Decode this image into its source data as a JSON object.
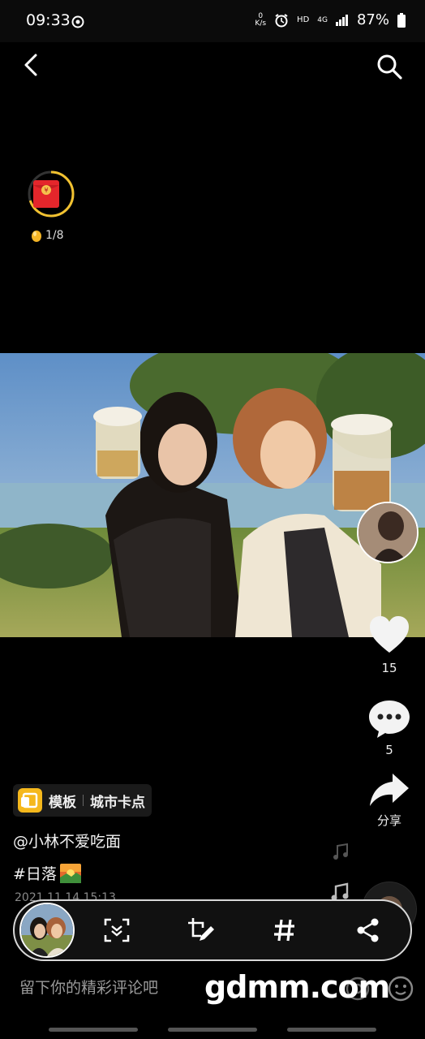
{
  "status_bar": {
    "time": "09:33",
    "net_speed_top": "0",
    "net_speed_bottom": "K/s",
    "hd": "HD",
    "network": "4G",
    "battery": "87%"
  },
  "nav": {
    "back_icon": "chevron-left-icon",
    "search_icon": "search-icon"
  },
  "reward": {
    "progress_text": "1/8",
    "progress_fraction": 0.125
  },
  "actions": {
    "likes": "15",
    "comments": "5",
    "share_label": "分享"
  },
  "post": {
    "template_label": "模板",
    "template_name": "城市卡点",
    "author": "@小林不爱吃面",
    "hashtag": "#日落",
    "datetime": "2021.11.14 15:13"
  },
  "comment": {
    "placeholder": "留下你的精彩评论吧"
  },
  "watermark": "gdmm.com"
}
